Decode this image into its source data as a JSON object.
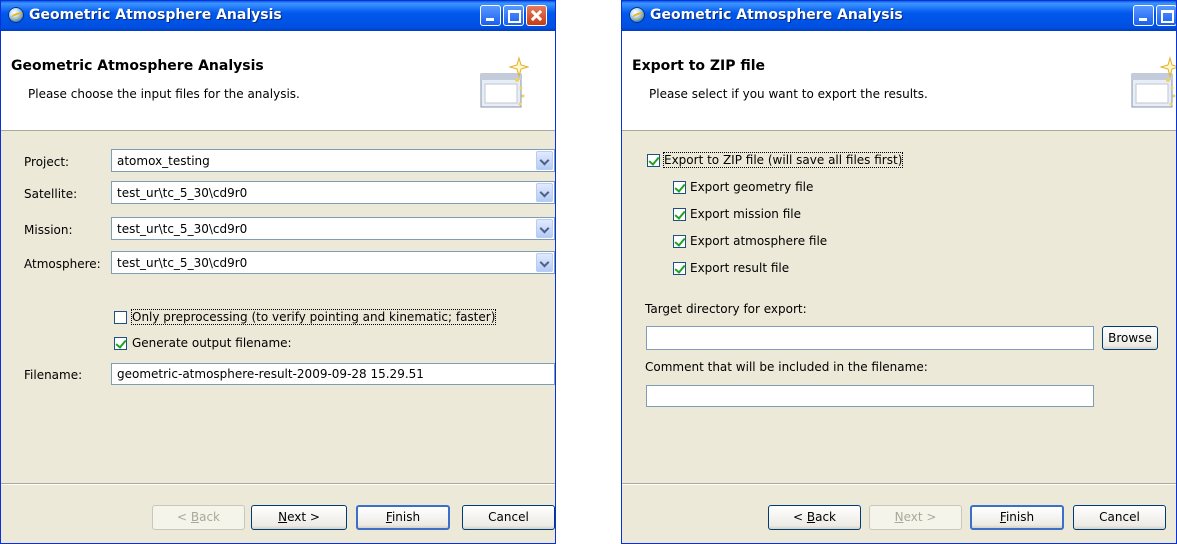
{
  "window1": {
    "title": "Geometric Atmosphere Analysis",
    "header": {
      "title": "Geometric Atmosphere Analysis",
      "subtitle": "Please choose the input files for the analysis."
    },
    "fields": {
      "project_label": "Project:",
      "project_value": "atomox_testing",
      "satellite_label": "Satellite:",
      "satellite_value": "test_ur\\tc_5_30\\cd9r0",
      "mission_label": "Mission:",
      "mission_value": "test_ur\\tc_5_30\\cd9r0",
      "atmosphere_label": "Atmosphere:",
      "atmosphere_value": "test_ur\\tc_5_30\\cd9r0",
      "filename_label": "Filename:",
      "filename_value": "geometric-atmosphere-result-2009-09-28 15.29.51"
    },
    "checkboxes": {
      "only_preprocessing": "Only preprocessing (to verify pointing and kinematic; faster)",
      "only_preprocessing_checked": false,
      "generate_filename": "Generate output filename:",
      "generate_filename_checked": true
    },
    "buttons": {
      "back_mn": "B",
      "back_rest": "ack",
      "back_prefix": "< ",
      "next_mn": "N",
      "next_rest": "ext >",
      "finish_mn": "F",
      "finish_rest": "inish",
      "cancel": "Cancel"
    }
  },
  "window2": {
    "title": "Geometric Atmosphere Analysis",
    "header": {
      "title": "Export to ZIP file",
      "subtitle": "Please select if you want to export the results."
    },
    "checkboxes": {
      "export_zip": "Export to ZIP file (will save all files first)",
      "export_geometry": "Export geometry file",
      "export_mission": "Export mission file",
      "export_atmosphere": "Export atmosphere file",
      "export_result": "Export result file"
    },
    "fields": {
      "target_label": "Target directory for export:",
      "target_value": "",
      "comment_label": "Comment that will be included in the filename:",
      "comment_value": ""
    },
    "buttons": {
      "browse": "Browse",
      "back_prefix": "< ",
      "back_mn": "B",
      "back_rest": "ack",
      "next_mn": "N",
      "next_rest": "ext >",
      "finish_mn": "F",
      "finish_rest": "inish",
      "cancel": "Cancel"
    }
  },
  "colors": {
    "titlebar": "#0058ee",
    "dialog_bg": "#ece9d8",
    "field_border": "#7f9db9",
    "check_mark": "#21a121"
  },
  "icons": {
    "app": "ie-globe-icon",
    "wizard": "wizard-window-sparkle-icon",
    "dropdown": "chevron-down-icon"
  }
}
